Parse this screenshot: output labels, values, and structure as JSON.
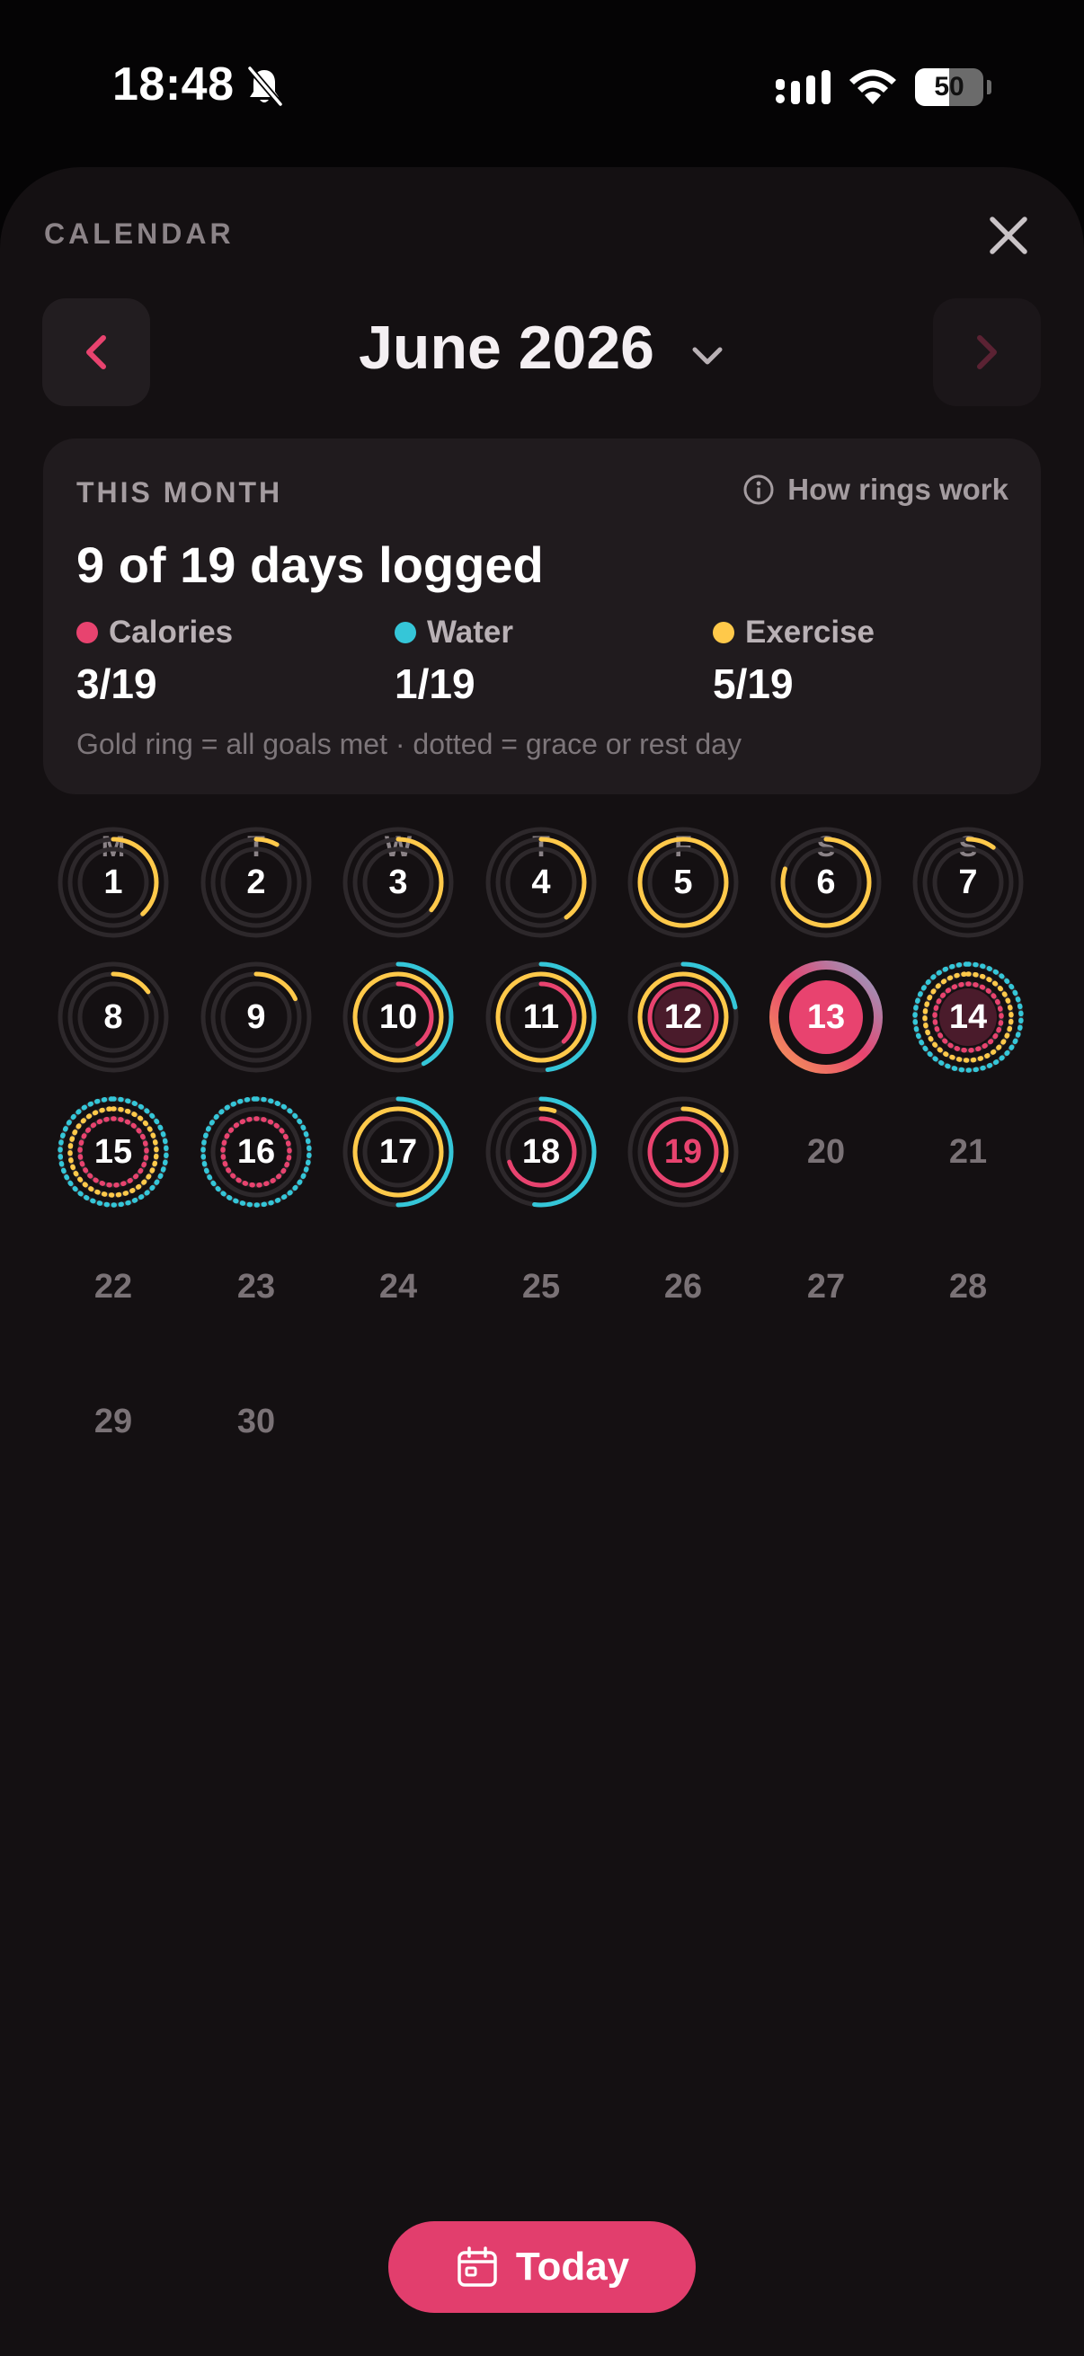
{
  "status_bar": {
    "time": "18:48",
    "battery_level": "50",
    "battery_fraction": 0.5
  },
  "sheet": {
    "title": "CALENDAR",
    "month_label": "June 2026"
  },
  "summary": {
    "label": "THIS MONTH",
    "how_rings": "How rings work",
    "headline": "9 of 19 days logged",
    "metrics": [
      {
        "name": "Calories",
        "value": "3/19",
        "color": "#e8436f"
      },
      {
        "name": "Water",
        "value": "1/19",
        "color": "#35c6d8"
      },
      {
        "name": "Exercise",
        "value": "5/19",
        "color": "#ffc94a"
      }
    ],
    "note": "Gold ring = all goals met · dotted = grace or rest day"
  },
  "colors": {
    "calories": "#e8436f",
    "water": "#35c6d8",
    "exercise": "#ffc94a",
    "track": "#2d282b",
    "accent": "#e23e6d"
  },
  "calendar": {
    "weekdays": [
      "M",
      "T",
      "W",
      "T",
      "F",
      "S",
      "S"
    ],
    "start_offset": 0,
    "days": [
      {
        "day": "1",
        "exercise": 0.38,
        "water": 0,
        "calories": 0
      },
      {
        "day": "2",
        "exercise": 0.08,
        "water": 0,
        "calories": 0
      },
      {
        "day": "3",
        "exercise": 0.36,
        "water": 0,
        "calories": 0
      },
      {
        "day": "4",
        "exercise": 0.4,
        "water": 0,
        "calories": 0
      },
      {
        "day": "5",
        "exercise": 1.0,
        "water": 0,
        "calories": 0
      },
      {
        "day": "6",
        "exercise": 0.8,
        "water": 0,
        "calories": 0
      },
      {
        "day": "7",
        "exercise": 0.1,
        "water": 0,
        "calories": 0
      },
      {
        "day": "8",
        "exercise": 0.15,
        "water": 0,
        "calories": 0
      },
      {
        "day": "9",
        "exercise": 0.18,
        "water": 0,
        "calories": 0
      },
      {
        "day": "10",
        "exercise": 1.0,
        "water": 0.42,
        "calories": 0.4
      },
      {
        "day": "11",
        "exercise": 1.0,
        "water": 0.48,
        "calories": 0.38
      },
      {
        "day": "12",
        "exercise": 1.0,
        "water": 0.22,
        "calories": 1.0,
        "filled": true
      },
      {
        "day": "13",
        "today": true
      },
      {
        "day": "14",
        "exercise": 1.0,
        "water": 1.0,
        "calories": 1.0,
        "dotted": true,
        "filled": true
      },
      {
        "day": "15",
        "exercise": 1.0,
        "water": 1.0,
        "calories": 1.0,
        "dotted": true
      },
      {
        "day": "16",
        "exercise": 0,
        "water": 0.12,
        "calories": 1.0,
        "dotted": true
      },
      {
        "day": "17",
        "exercise": 1.0,
        "water": 0.5,
        "calories": 0
      },
      {
        "day": "18",
        "exercise": 0.05,
        "water": 0.52,
        "calories": 0.7
      },
      {
        "day": "19",
        "exercise": 0.32,
        "water": 0,
        "calories": 1.0,
        "pink_number": true
      },
      {
        "day": "20",
        "future": true
      },
      {
        "day": "21",
        "future": true
      },
      {
        "day": "22",
        "future": true
      },
      {
        "day": "23",
        "future": true
      },
      {
        "day": "24",
        "future": true
      },
      {
        "day": "25",
        "future": true
      },
      {
        "day": "26",
        "future": true
      },
      {
        "day": "27",
        "future": true
      },
      {
        "day": "28",
        "future": true
      },
      {
        "day": "29",
        "future": true
      },
      {
        "day": "30",
        "future": true
      }
    ]
  },
  "today_button": {
    "label": "Today"
  }
}
